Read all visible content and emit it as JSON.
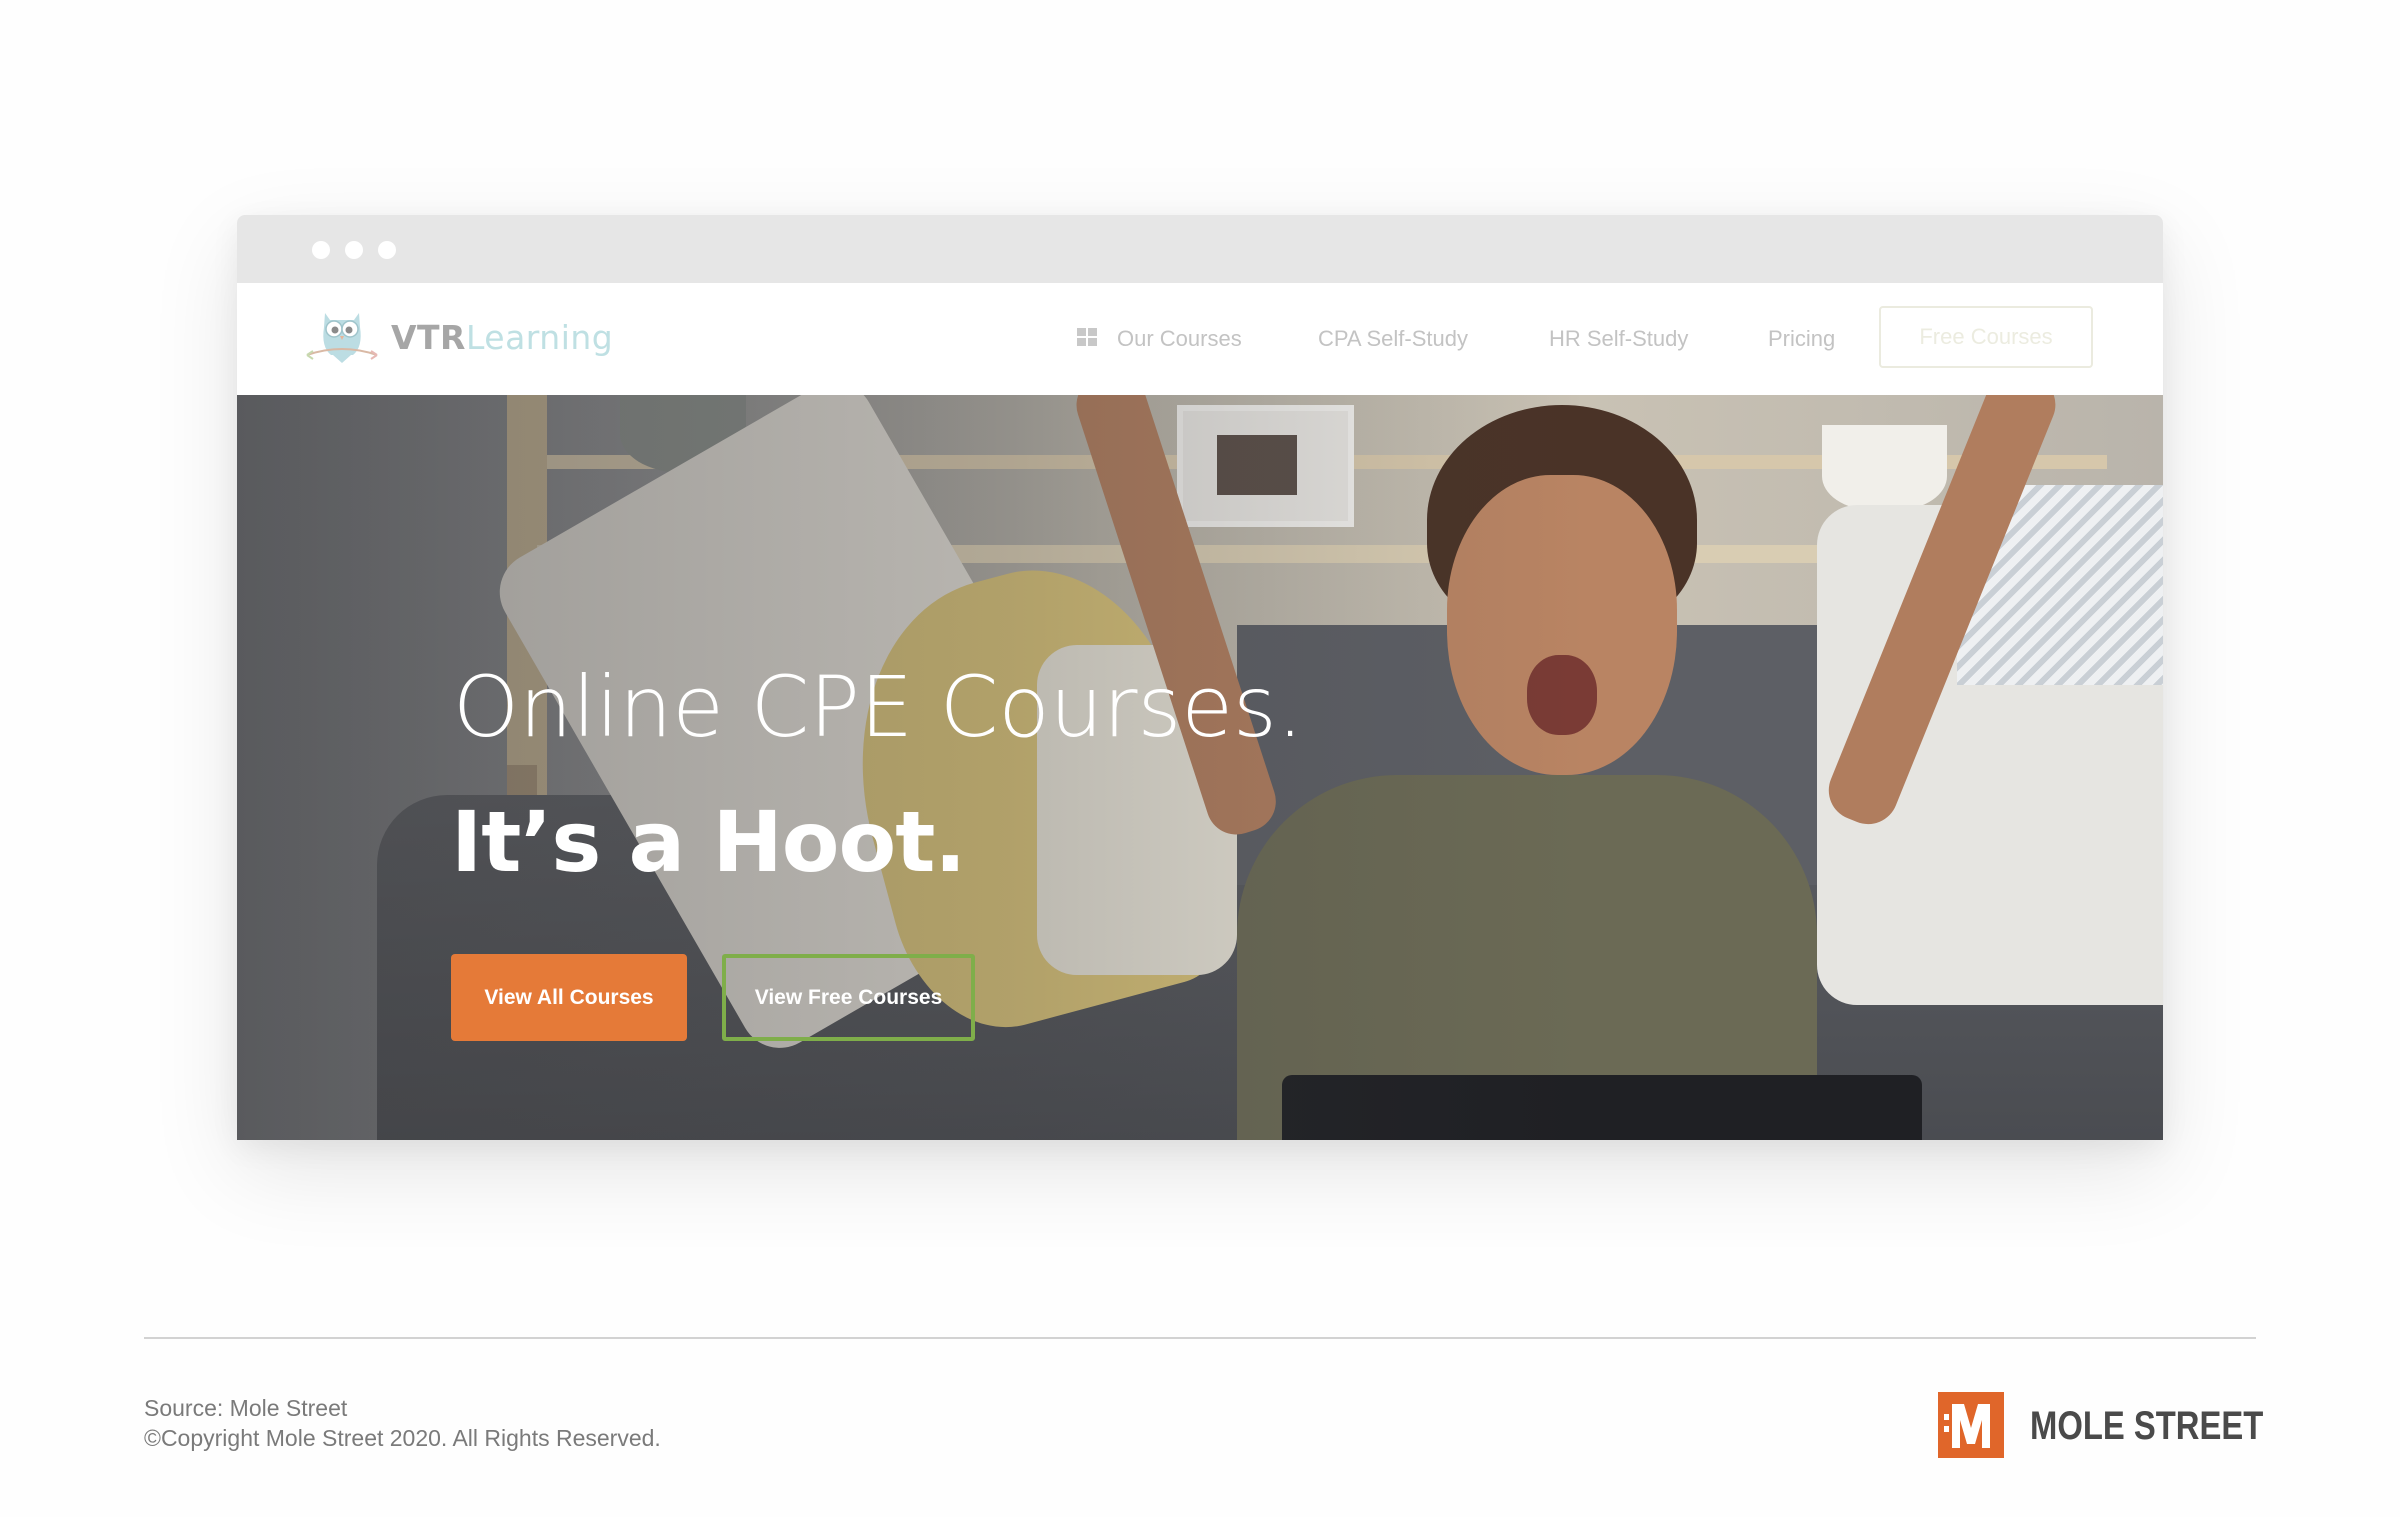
{
  "browser": {
    "window_dots": [
      "dot-1",
      "dot-2",
      "dot-3"
    ]
  },
  "site": {
    "logo": {
      "brand_primary": "VTR",
      "brand_secondary": "Learning",
      "icon": "owl-icon"
    },
    "nav": {
      "items": [
        {
          "label": "Our Courses",
          "icon": "grid-icon"
        },
        {
          "label": "CPA Self-Study"
        },
        {
          "label": "HR Self-Study"
        },
        {
          "label": "Pricing"
        }
      ],
      "cta_label": "Free Courses"
    },
    "hero": {
      "headline_line1": "Online CPE Courses.",
      "headline_line2": "It’s a Hoot.",
      "primary_button": "View All Courses",
      "secondary_button": "View Free Courses",
      "image_description": "Excited woman with raised arms in front of a laptop on a gray sofa"
    },
    "colors": {
      "primary_orange": "#e57a38",
      "outline_green": "#7fae4a",
      "nav_text": "#c3c3c3"
    }
  },
  "footer": {
    "source": "Source: Mole Street",
    "copyright": "©Copyright Mole Street 2020. All Rights Reserved.",
    "brand_name": "MOLE STREET",
    "brand_icon_letter": "M",
    "brand_color": "#e0662a"
  }
}
